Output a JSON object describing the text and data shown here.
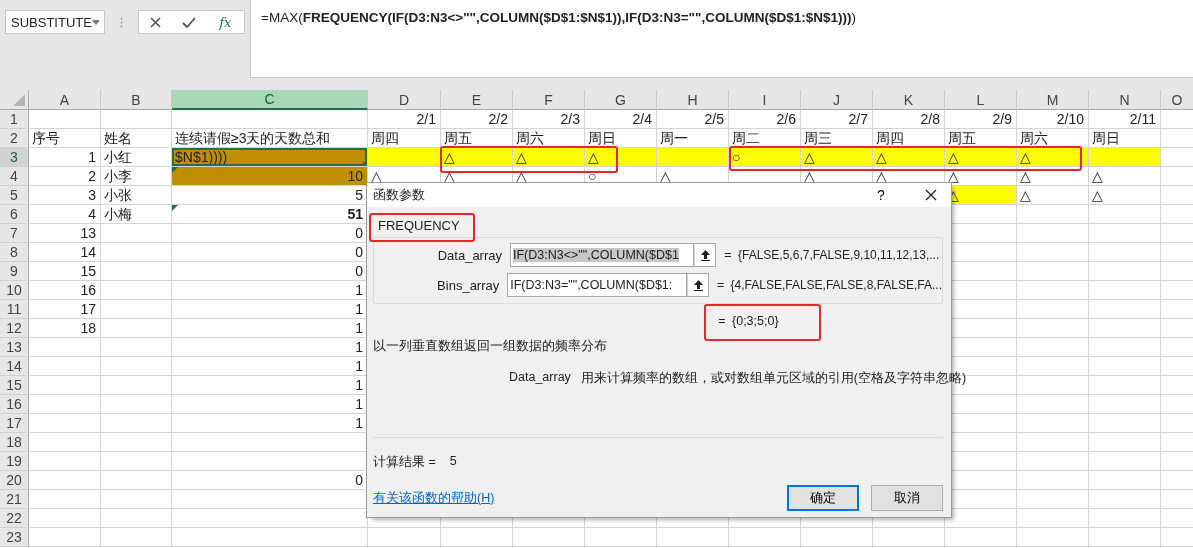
{
  "name_box": {
    "value": "SUBSTITUTE"
  },
  "formula_bar": {
    "function_button": "fx",
    "formula": "=MAX(**FREQUENCY(IF(D3:N3<>\"\",COLUMN($D$1:$N$1)),IF(D3:N3=\"\",COLUMN($D$1:$N$1)))**)"
  },
  "columns": [
    {
      "label": "A",
      "selected": false
    },
    {
      "label": "B",
      "selected": false
    },
    {
      "label": "C",
      "selected": true
    },
    {
      "label": "D",
      "selected": false
    },
    {
      "label": "E",
      "selected": false
    },
    {
      "label": "F",
      "selected": false
    },
    {
      "label": "G",
      "selected": false
    },
    {
      "label": "H",
      "selected": false
    },
    {
      "label": "I",
      "selected": false
    },
    {
      "label": "J",
      "selected": false
    },
    {
      "label": "K",
      "selected": false
    },
    {
      "label": "L",
      "selected": false
    },
    {
      "label": "M",
      "selected": false
    },
    {
      "label": "N",
      "selected": false
    },
    {
      "label": "O",
      "selected": false
    }
  ],
  "rows": [
    {
      "number": "1",
      "selected": false,
      "cells": [
        {
          "kind": "blank"
        },
        {
          "kind": "blank"
        },
        {
          "kind": "blank"
        },
        {
          "kind": "number",
          "text": "2/1"
        },
        {
          "kind": "number",
          "text": "2/2"
        },
        {
          "kind": "number",
          "text": "2/3"
        },
        {
          "kind": "number",
          "text": "2/4"
        },
        {
          "kind": "number",
          "text": "2/5"
        },
        {
          "kind": "number",
          "text": "2/6"
        },
        {
          "kind": "number",
          "text": "2/7"
        },
        {
          "kind": "number",
          "text": "2/8"
        },
        {
          "kind": "number",
          "text": "2/9"
        },
        {
          "kind": "number",
          "text": "2/10"
        },
        {
          "kind": "number",
          "text": "2/11"
        }
      ]
    },
    {
      "number": "2",
      "selected": false,
      "cells": [
        {
          "kind": "text",
          "text": "序号"
        },
        {
          "kind": "text",
          "text": "姓名"
        },
        {
          "kind": "text",
          "text": "连续请假≥3天的天数总和"
        },
        {
          "kind": "text",
          "text": "周四"
        },
        {
          "kind": "text",
          "text": "周五"
        },
        {
          "kind": "text",
          "text": "周六"
        },
        {
          "kind": "text",
          "text": "周日"
        },
        {
          "kind": "text",
          "text": "周一"
        },
        {
          "kind": "text",
          "text": "周二"
        },
        {
          "kind": "text",
          "text": "周三"
        },
        {
          "kind": "text",
          "text": "周四"
        },
        {
          "kind": "text",
          "text": "周五"
        },
        {
          "kind": "text",
          "text": "周六"
        },
        {
          "kind": "text",
          "text": "周日"
        }
      ]
    },
    {
      "number": "3",
      "selected": true,
      "cells": [
        {
          "kind": "number",
          "text": "1"
        },
        {
          "kind": "text",
          "text": "小红"
        },
        {
          "kind": "text",
          "text": "$N$1))))",
          "color": "#bf8f00",
          "active": true
        },
        {
          "kind": "text",
          "color": "#ffff00"
        },
        {
          "kind": "text",
          "text": "△",
          "color": "#ffff00"
        },
        {
          "kind": "text",
          "text": "△",
          "color": "#ffff00"
        },
        {
          "kind": "text",
          "text": "△",
          "color": "#ffff00"
        },
        {
          "kind": "text",
          "color": "#ffff00"
        },
        {
          "kind": "text",
          "text": "○",
          "color": "#ffff00"
        },
        {
          "kind": "text",
          "text": "△",
          "color": "#ffff00"
        },
        {
          "kind": "text",
          "text": "△",
          "color": "#ffff00"
        },
        {
          "kind": "text",
          "text": "△",
          "color": "#ffff00"
        },
        {
          "kind": "text",
          "text": "△",
          "color": "#ffff00"
        },
        {
          "kind": "text",
          "color": "#ffff00"
        }
      ]
    },
    {
      "number": "4",
      "selected": false,
      "cells": [
        {
          "kind": "number",
          "text": "2"
        },
        {
          "kind": "text",
          "text": "小李"
        },
        {
          "kind": "number",
          "text": "10",
          "color": "#bf8f00",
          "error_flag": true
        },
        {
          "kind": "text",
          "text": "△"
        },
        {
          "kind": "text",
          "text": "△"
        },
        {
          "kind": "text",
          "text": "△"
        },
        {
          "kind": "text",
          "text": "○"
        },
        {
          "kind": "text",
          "text": "△"
        },
        {
          "kind": "blank"
        },
        {
          "kind": "text",
          "text": "△"
        },
        {
          "kind": "text",
          "text": "△"
        },
        {
          "kind": "text",
          "text": "△"
        },
        {
          "kind": "text",
          "text": "△"
        },
        {
          "kind": "text",
          "text": "△"
        }
      ]
    },
    {
      "number": "5",
      "selected": false,
      "cells": [
        {
          "kind": "number",
          "text": "3"
        },
        {
          "kind": "text",
          "text": "小张"
        },
        {
          "kind": "number",
          "text": "5"
        },
        {
          "kind": "blank"
        },
        {
          "kind": "blank"
        },
        {
          "kind": "blank"
        },
        {
          "kind": "blank"
        },
        {
          "kind": "blank"
        },
        {
          "kind": "blank"
        },
        {
          "kind": "blank"
        },
        {
          "kind": "blank"
        },
        {
          "kind": "text",
          "text": "△",
          "color": "#ffff00"
        },
        {
          "kind": "text",
          "text": "△"
        },
        {
          "kind": "text",
          "text": "△"
        }
      ]
    },
    {
      "number": "6",
      "selected": false,
      "cells": [
        {
          "kind": "number",
          "text": "4"
        },
        {
          "kind": "text",
          "text": "小梅"
        },
        {
          "kind": "number",
          "text": "51",
          "bold": true,
          "error_flag": true
        }
      ]
    },
    {
      "number": "7",
      "selected": false,
      "cells": [
        {
          "kind": "number",
          "text": "13"
        },
        {
          "kind": "blank"
        },
        {
          "kind": "number",
          "text": "0"
        }
      ]
    },
    {
      "number": "8",
      "selected": false,
      "cells": [
        {
          "kind": "number",
          "text": "14"
        },
        {
          "kind": "blank"
        },
        {
          "kind": "number",
          "text": "0"
        }
      ]
    },
    {
      "number": "9",
      "selected": false,
      "cells": [
        {
          "kind": "number",
          "text": "15"
        },
        {
          "kind": "blank"
        },
        {
          "kind": "number",
          "text": "0"
        }
      ]
    },
    {
      "number": "10",
      "selected": false,
      "cells": [
        {
          "kind": "number",
          "text": "16"
        },
        {
          "kind": "blank"
        },
        {
          "kind": "number",
          "text": "1"
        }
      ]
    },
    {
      "number": "11",
      "selected": false,
      "cells": [
        {
          "kind": "number",
          "text": "17"
        },
        {
          "kind": "blank"
        },
        {
          "kind": "number",
          "text": "1"
        }
      ]
    },
    {
      "number": "12",
      "selected": false,
      "cells": [
        {
          "kind": "number",
          "text": "18"
        },
        {
          "kind": "blank"
        },
        {
          "kind": "number",
          "text": "1"
        }
      ]
    },
    {
      "number": "13",
      "selected": false,
      "cells": [
        {
          "kind": "blank"
        },
        {
          "kind": "blank"
        },
        {
          "kind": "number",
          "text": "1"
        }
      ]
    },
    {
      "number": "14",
      "selected": false,
      "cells": [
        {
          "kind": "blank"
        },
        {
          "kind": "blank"
        },
        {
          "kind": "number",
          "text": "1"
        }
      ]
    },
    {
      "number": "15",
      "selected": false,
      "cells": [
        {
          "kind": "blank"
        },
        {
          "kind": "blank"
        },
        {
          "kind": "number",
          "text": "1"
        }
      ]
    },
    {
      "number": "16",
      "selected": false,
      "cells": [
        {
          "kind": "blank"
        },
        {
          "kind": "blank"
        },
        {
          "kind": "number",
          "text": "1"
        }
      ]
    },
    {
      "number": "17",
      "selected": false,
      "cells": [
        {
          "kind": "blank"
        },
        {
          "kind": "blank"
        },
        {
          "kind": "number",
          "text": "1"
        }
      ]
    },
    {
      "number": "18",
      "selected": false,
      "cells": []
    },
    {
      "number": "19",
      "selected": false,
      "cells": []
    },
    {
      "number": "20",
      "selected": false,
      "cells": [
        {
          "kind": "blank"
        },
        {
          "kind": "blank"
        },
        {
          "kind": "number",
          "text": "0"
        }
      ]
    },
    {
      "number": "21",
      "selected": false,
      "cells": []
    },
    {
      "number": "22",
      "selected": false,
      "cells": []
    },
    {
      "number": "23",
      "selected": false,
      "cells": []
    }
  ],
  "dialog": {
    "title": "函数参数",
    "help_button": "?",
    "function_name": "FREQUENCY",
    "arguments": [
      {
        "label": "Data_array",
        "value": "IF(D3:N3<>\"\",COLUMN($D$1",
        "highlighted": true,
        "equals": "=",
        "result": "{FALSE,5,6,7,FALSE,9,10,11,12,13,..."
      },
      {
        "label": "Bins_array",
        "value": "IF(D3:N3=\"\",COLUMN($D$1:",
        "highlighted": false,
        "equals": "=",
        "result": "{4,FALSE,FALSE,FALSE,8,FALSE,FA..."
      }
    ],
    "formula_equals": "=",
    "formula_result": "{0;3;5;0}",
    "description": "以一列垂直数组返回一组数据的频率分布",
    "argument_help": {
      "name": "Data_array",
      "text": "用来计算频率的数组，或对数组单元区域的引用(空格及字符串忽略)"
    },
    "result_label": "计算结果 =",
    "result_value": "5",
    "help_link": "有关该函数的帮助(H)",
    "buttons": [
      {
        "label": "确定",
        "default": true
      },
      {
        "label": "取消",
        "default": false
      }
    ]
  }
}
